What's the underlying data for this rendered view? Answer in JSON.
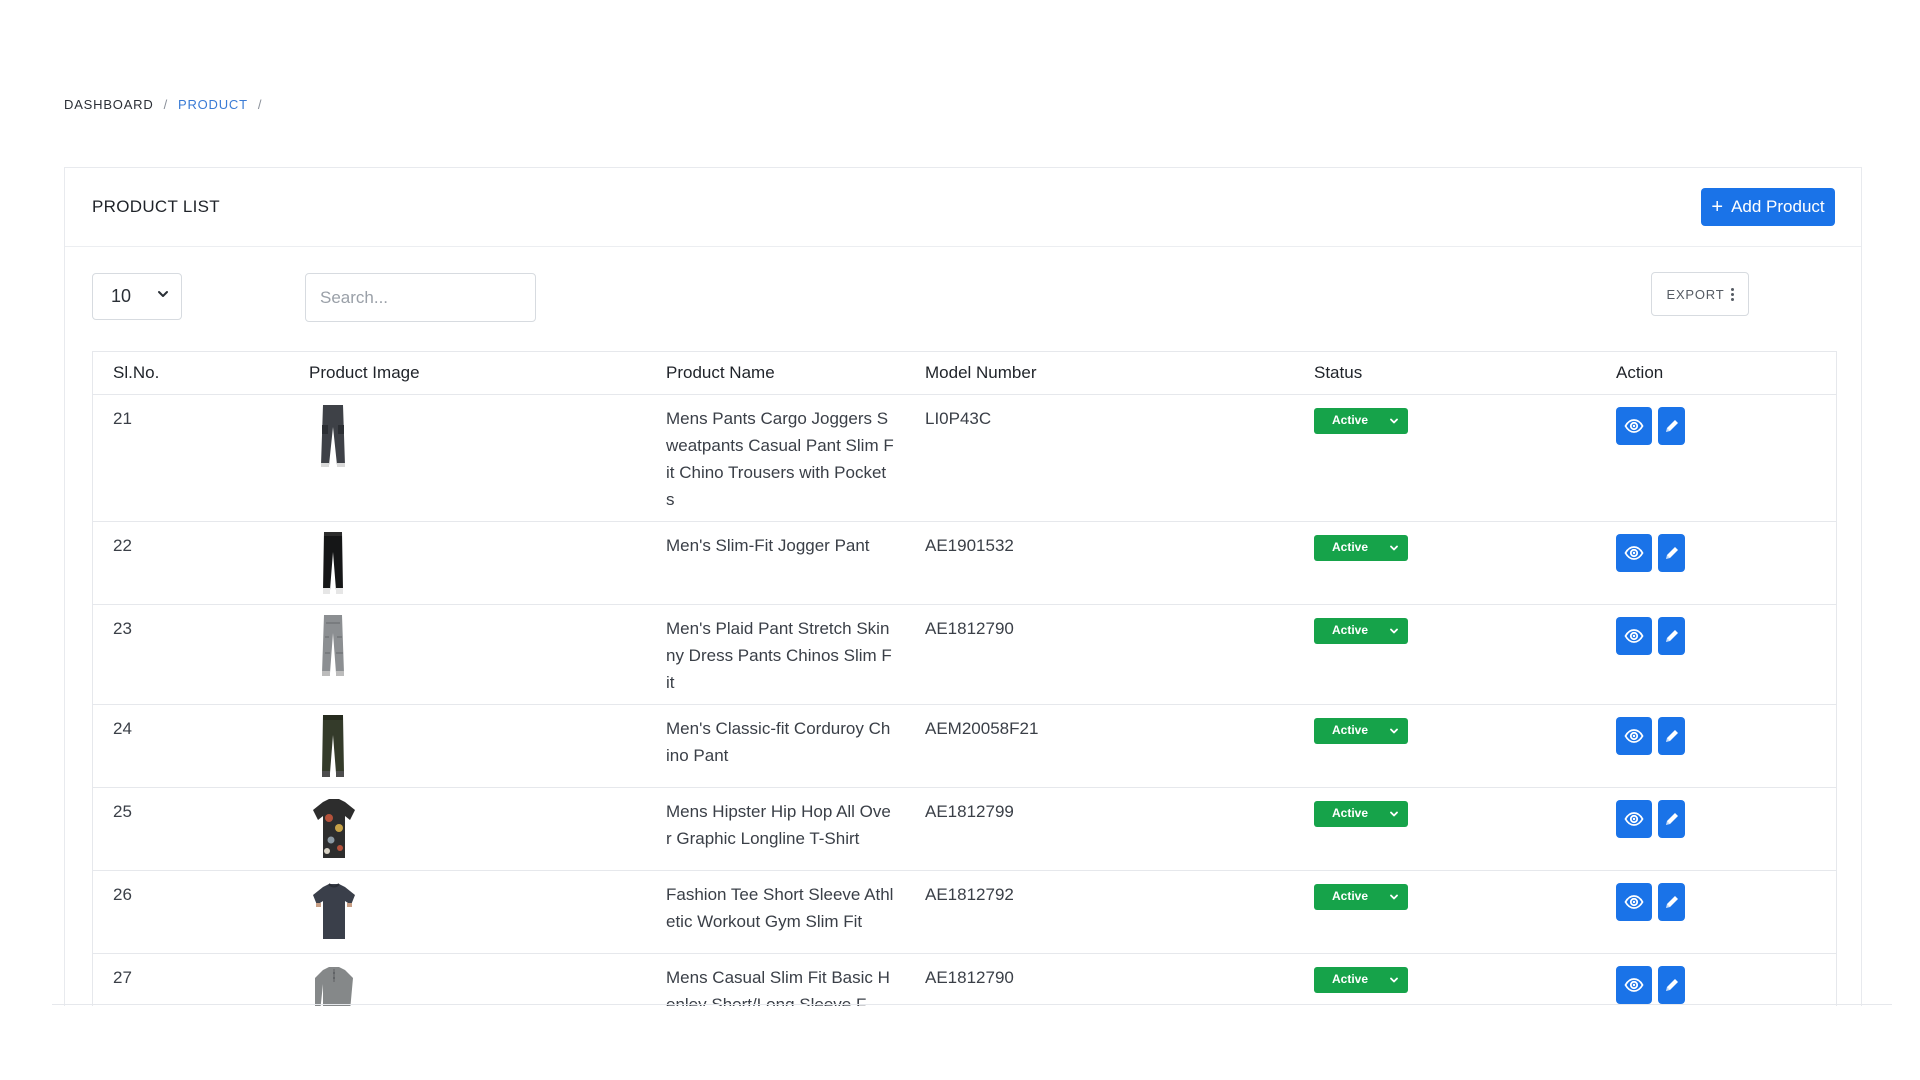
{
  "breadcrumb": {
    "root": "DASHBOARD",
    "current": "PRODUCT",
    "sep": "/"
  },
  "card": {
    "title": "PRODUCT LIST",
    "add_button_label": "Add Product"
  },
  "controls": {
    "page_size": "10",
    "search_placeholder": "Search...",
    "export_label": "EXPORT"
  },
  "table": {
    "headers": [
      "Sl.No.",
      "Product Image",
      "Product Name",
      "Model Number",
      "Status",
      "Action"
    ],
    "rows": [
      {
        "sl": "21",
        "name": "Mens Pants Cargo Joggers Sweatpants Casual Pant Slim Fit Chino Trousers with Pockets",
        "model": "LI0P43C",
        "status": "Active",
        "image": "cargo-jogger-pants"
      },
      {
        "sl": "22",
        "name": "Men's Slim-Fit Jogger Pant",
        "model": "AE1901532",
        "status": "Active",
        "image": "black-jogger-pants"
      },
      {
        "sl": "23",
        "name": "Men's Plaid Pant Stretch Skinny Dress Pants Chinos Slim Fit",
        "model": "AE1812790",
        "status": "Active",
        "image": "grey-plaid-pants"
      },
      {
        "sl": "24",
        "name": "Men's Classic-fit Corduroy Chino Pant",
        "model": "AEM20058F21",
        "status": "Active",
        "image": "olive-corduroy-pants"
      },
      {
        "sl": "25",
        "name": "Mens Hipster Hip Hop All Over Graphic Longline T-Shirt",
        "model": "AE1812799",
        "status": "Active",
        "image": "graphic-tshirt"
      },
      {
        "sl": "26",
        "name": "Fashion Tee Short Sleeve Athletic Workout Gym Slim Fit",
        "model": "AE1812792",
        "status": "Active",
        "image": "navy-tshirt"
      },
      {
        "sl": "27",
        "name": "Mens Casual Slim Fit Basic Henley Short/Long Sleeve F",
        "model": "AE1812790",
        "status": "Active",
        "image": "grey-henley-shirt"
      }
    ]
  },
  "colors": {
    "primary": "#1a73e8",
    "status_active": "#16a34a",
    "breadcrumb_active": "#3a7bd5"
  },
  "icons": {
    "view": "eye-icon",
    "edit": "pencil-icon",
    "add": "plus-icon",
    "export_menu": "kebab-icon",
    "dropdown": "chevron-down-icon"
  }
}
